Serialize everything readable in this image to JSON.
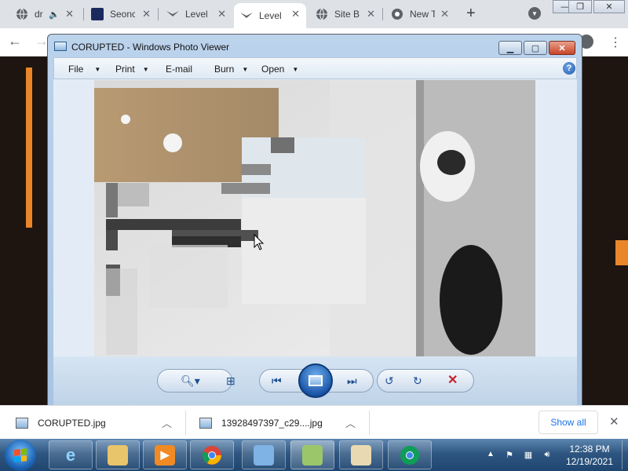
{
  "browser": {
    "tabs": [
      {
        "title": "dr",
        "icon": "globe-icon",
        "audio": true
      },
      {
        "title": "Seonc",
        "icon": "site-logo-icon"
      },
      {
        "title": "Level",
        "icon": "bird-icon"
      },
      {
        "title": "Level",
        "icon": "bird-icon",
        "active": true
      },
      {
        "title": "Site B",
        "icon": "globe-icon"
      },
      {
        "title": "New T",
        "icon": "chrome-icon"
      }
    ],
    "new_tab_label": "+",
    "window_controls": {
      "minimize": "—",
      "maximize": "❐",
      "close": "✕"
    }
  },
  "photo_viewer": {
    "title": "CORUPTED - Windows Photo Viewer",
    "menu": {
      "file": "File",
      "print": "Print",
      "email": "E-mail",
      "burn": "Burn",
      "open": "Open",
      "help": "?"
    },
    "controls": {
      "zoom": "zoom-icon",
      "fit": "actual-size-icon",
      "previous": "previous-icon",
      "slideshow": "slideshow-icon",
      "next": "next-icon",
      "rotate_ccw": "rotate-counterclockwise-icon",
      "rotate_cw": "rotate-clockwise-icon",
      "delete": "delete-icon"
    },
    "colors": {
      "frame": "#bcd3ec",
      "viewport": "#e3ecf6",
      "delete": "#c8202a"
    }
  },
  "downloads": {
    "items": [
      {
        "name": "CORUPTED.jpg"
      },
      {
        "name": "13928497397_c29....jpg"
      }
    ],
    "show_all": "Show all",
    "caret": "^",
    "close": "✕"
  },
  "taskbar": {
    "pinned": [
      "internet-explorer-icon",
      "file-explorer-icon",
      "media-player-icon",
      "chrome-icon",
      "control-panel-icon",
      "photo-viewer-icon",
      "paint-icon",
      "chrome-alt-icon"
    ],
    "clock": {
      "time": "12:38 PM",
      "date": "12/19/2021"
    }
  }
}
